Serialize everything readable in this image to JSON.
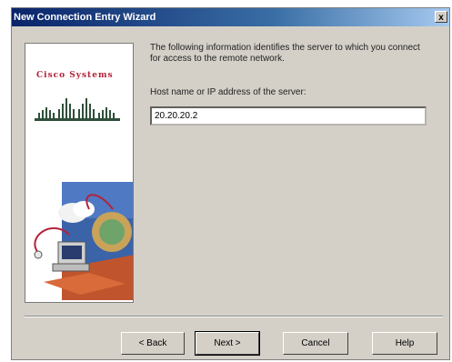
{
  "window": {
    "title": "New Connection Entry Wizard",
    "close_glyph": "x"
  },
  "side_panel": {
    "logo_text": "Cisco Systems"
  },
  "main": {
    "instructions": "The following information identifies the server to which you connect for access to the remote network.",
    "host_label": "Host name or IP address of the server:",
    "host_value": "20.20.20.2"
  },
  "buttons": {
    "back": "< Back",
    "next": "Next >",
    "cancel": "Cancel",
    "help": "Help"
  },
  "colors": {
    "title_start": "#0a246a",
    "title_end": "#a6caf0",
    "dialog_bg": "#d4d0c8",
    "logo_red": "#b3223a"
  }
}
